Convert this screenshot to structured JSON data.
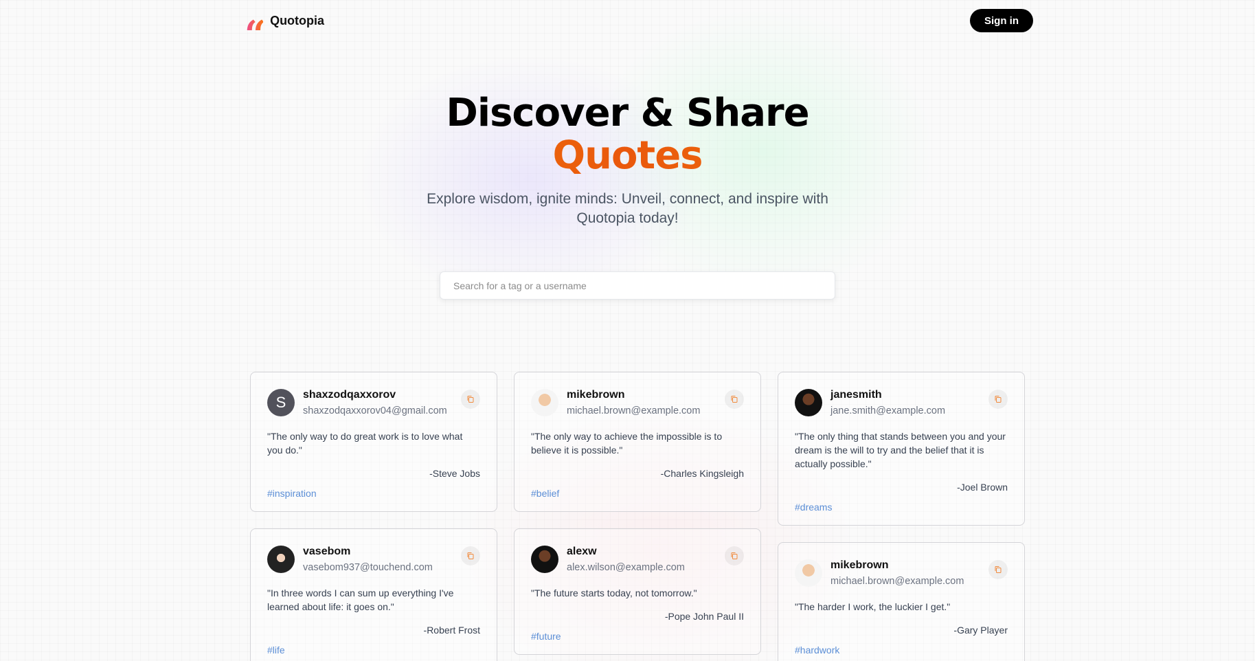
{
  "brand": {
    "name": "Quotopia",
    "logo_icon": "quote-mark-icon",
    "accent_from": "#ec4899",
    "accent_to": "#f97316"
  },
  "nav": {
    "signin_label": "Sign in"
  },
  "hero": {
    "title": "Discover & Share",
    "title_accent": "Quotes",
    "subtitle": "Explore wisdom, ignite minds: Unveil, connect, and inspire with Quotopia today!"
  },
  "search": {
    "placeholder": "Search for a tag or a username",
    "value": ""
  },
  "columns": [
    [
      {
        "username": "shaxzodqaxxorov",
        "email": "shaxzodqaxxorov04@gmail.com",
        "avatar": "S",
        "quote": "\"The only way to do great work is to love what you do.\"",
        "author": "-Steve Jobs",
        "tag": "#inspiration"
      },
      {
        "username": "vasebom",
        "email": "vasebom937@touchend.com",
        "avatar": "",
        "quote": "\"In three words I can sum up everything I've learned about life: it goes on.\"",
        "author": "-Robert Frost",
        "tag": "#life"
      }
    ],
    [
      {
        "username": "mikebrown",
        "email": "michael.brown@example.com",
        "avatar": "",
        "quote": "\"The only way to achieve the impossible is to believe it is possible.\"",
        "author": "-Charles Kingsleigh",
        "tag": "#belief"
      },
      {
        "username": "alexw",
        "email": "alex.wilson@example.com",
        "avatar": "",
        "quote": "\"The future starts today, not tomorrow.\"",
        "author": "-Pope John Paul II",
        "tag": "#future"
      }
    ],
    [
      {
        "username": "janesmith",
        "email": "jane.smith@example.com",
        "avatar": "",
        "quote": "\"The only thing that stands between you and your dream is the will to try and the belief that it is actually possible.\"",
        "author": "-Joel Brown",
        "tag": "#dreams"
      },
      {
        "username": "mikebrown",
        "email": "michael.brown@example.com",
        "avatar": "",
        "quote": "\"The harder I work, the luckier I get.\"",
        "author": "-Gary Player",
        "tag": "#hardwork"
      }
    ]
  ],
  "icons": {
    "copy": "copy-icon"
  }
}
